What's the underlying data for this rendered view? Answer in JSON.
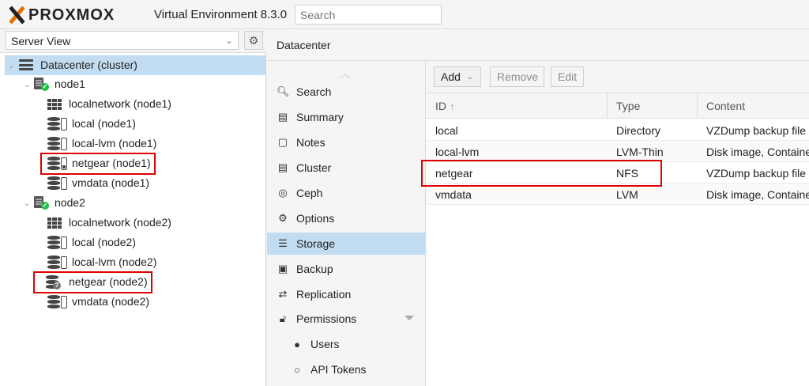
{
  "topbar": {
    "logo_text": "PROXMOX",
    "title": "Virtual Environment 8.3.0",
    "search_placeholder": "Search"
  },
  "left": {
    "view_select": "Server View",
    "tree": {
      "datacenter": "Datacenter (cluster)",
      "nodes": [
        {
          "name": "node1",
          "items": [
            "localnetwork (node1)",
            "local (node1)",
            "local-lvm (node1)",
            "netgear (node1)",
            "vmdata (node1)"
          ]
        },
        {
          "name": "node2",
          "items": [
            "localnetwork (node2)",
            "local (node2)",
            "local-lvm (node2)",
            "netgear (node2)",
            "vmdata (node2)"
          ]
        }
      ]
    }
  },
  "main": {
    "title": "Datacenter",
    "menu": [
      {
        "label": "Search",
        "icon": "search-icon"
      },
      {
        "label": "Summary",
        "icon": "book-icon"
      },
      {
        "label": "Notes",
        "icon": "notes-icon"
      },
      {
        "label": "Cluster",
        "icon": "server-icon"
      },
      {
        "label": "Ceph",
        "icon": "ceph-icon"
      },
      {
        "label": "Options",
        "icon": "gear-icon"
      },
      {
        "label": "Storage",
        "icon": "database-icon",
        "selected": true
      },
      {
        "label": "Backup",
        "icon": "floppy-icon"
      },
      {
        "label": "Replication",
        "icon": "retweet-icon"
      },
      {
        "label": "Permissions",
        "icon": "unlock-icon"
      },
      {
        "label": "Users",
        "icon": "user-icon"
      },
      {
        "label": "API Tokens",
        "icon": "user-outline-icon"
      }
    ],
    "toolbar": {
      "add": "Add",
      "remove": "Remove",
      "edit": "Edit"
    },
    "columns": [
      "ID",
      "Type",
      "Content"
    ],
    "rows": [
      {
        "id": "local",
        "type": "Directory",
        "content": "VZDump backup file"
      },
      {
        "id": "local-lvm",
        "type": "LVM-Thin",
        "content": "Disk image, Container"
      },
      {
        "id": "netgear",
        "type": "NFS",
        "content": "VZDump backup file"
      },
      {
        "id": "vmdata",
        "type": "LVM",
        "content": "Disk image, Container"
      }
    ]
  },
  "colors": {
    "accent": "#e57000",
    "selection": "#c2ddf2",
    "highlight": "#e00000",
    "status_ok": "#21bf4b"
  }
}
